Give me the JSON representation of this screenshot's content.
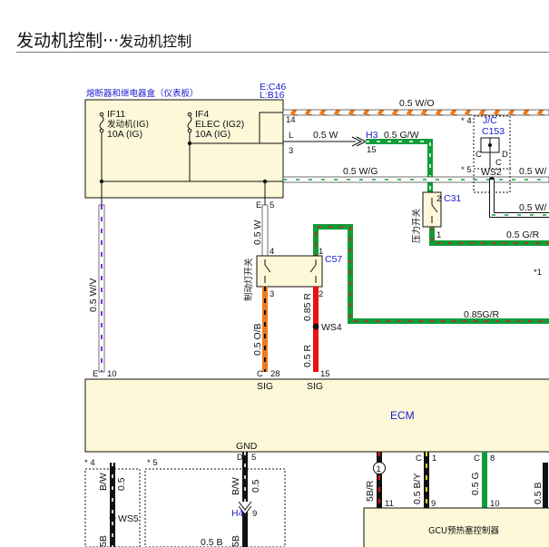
{
  "header": {
    "title": "发动机控制",
    "separator": "···",
    "subtitle": "发动机控制"
  },
  "fuse_box": {
    "label": "熔断器和继电器盒（仪表板）",
    "connector_e": "E:C46",
    "connector_l": "L:B16",
    "fuse1": {
      "name": "IF11",
      "circuit": "发动机(IG)",
      "rating": "10A (IG)"
    },
    "fuse2": {
      "name": "IF4",
      "circuit": "ELEC (IG2)",
      "rating": "10A (IG)"
    },
    "pins": {
      "p14": "14",
      "pL": "L",
      "p3": "3",
      "pE": "E",
      "p5": "5"
    }
  },
  "wires": {
    "top_wo": "0.5 W/O",
    "w_to_h3": "0.5 W",
    "h3": "H3",
    "h3_pin": "15",
    "h3_gw": "0.5 G/W",
    "wg": "0.5 W/G",
    "right_w": "0.5 W",
    "gr": "0.5 G/R",
    "gr_bottom": "0.85G/R",
    "wv": "0.5 W/V",
    "w_to_switch": "0.5 W",
    "ob": "0.5 O/B",
    "r_085": "0.85 R",
    "r_05": "0.5 R",
    "ws4": "WS4"
  },
  "junction": {
    "star4": "* 4",
    "star5": "* 5",
    "jc": "J/C",
    "c153": "C153",
    "ws2": "WS2",
    "pin_c": "C",
    "pin_d": "D",
    "pin_c2": "C",
    "right_label": "0.5 W/"
  },
  "pressure_switch": {
    "label": "压力开关",
    "connector": "C31",
    "pin2": "2",
    "pin1": "1"
  },
  "brake_switch": {
    "label": "制动灯开关",
    "connector": "C57",
    "pin4": "4",
    "pin1": "1",
    "pin3": "3",
    "pin2": "2"
  },
  "ecm": {
    "label": "ECM",
    "pin_e": "E",
    "pin_10": "10",
    "pin_c": "C",
    "pin_28": "28",
    "pin_15": "15",
    "sig1": "SIG",
    "sig2": "SIG",
    "gnd": "GND",
    "gnd_d": "D",
    "gnd_5": "5"
  },
  "bottom": {
    "star4": "* 4",
    "star5": "* 5",
    "bw1": "B/W",
    "w05a": "0.5",
    "ws5": "WS5",
    "b_left": "5B",
    "bw2": "B/W",
    "w05b": "0.5",
    "h4": "H4",
    "h4_pin": "9",
    "b05": "0.5 B",
    "b_mid": "5B",
    "br": "5B/R",
    "circle1": "1",
    "pin11": "11",
    "by": "0.5 B/Y",
    "pin_c_by": "C",
    "pin_1": "1",
    "pin_9": "9",
    "g": "0.5 G",
    "pin_c_g": "C",
    "pin_8": "8",
    "pin_10": "10",
    "b_right": "0.5 B",
    "gcu": "GCU预热塞控制器",
    "star1": "*1"
  },
  "colors": {
    "wire_white": "#ffffff",
    "violet": "#8a2be2",
    "green": "#0f9d3a",
    "orange": "#ee7a1b",
    "red": "#ee1111",
    "black": "#111111",
    "box_fill": "#fdf8d8",
    "label_blue": "#1a1ad0"
  }
}
